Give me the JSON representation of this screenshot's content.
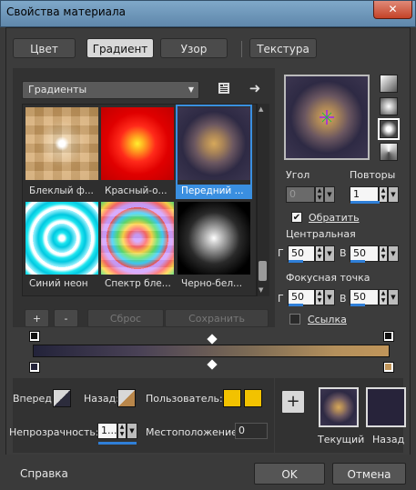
{
  "window": {
    "title": "Свойства материала",
    "close_label": "✕"
  },
  "tabs": [
    {
      "label": "Цвет"
    },
    {
      "label": "Градиент"
    },
    {
      "label": "Узор"
    },
    {
      "label": "Текстура"
    }
  ],
  "gallery": {
    "category": "Градиенты",
    "items": [
      {
        "label": "Блеклый ф..."
      },
      {
        "label": "Красный-о..."
      },
      {
        "label": "Передний ..."
      },
      {
        "label": "Синий неон"
      },
      {
        "label": "Спектр бле..."
      },
      {
        "label": "Черно-бел..."
      }
    ],
    "selected_index": 2
  },
  "gallery_buttons": {
    "add": "+",
    "remove": "-",
    "reset": "Сброс",
    "save": "Сохранить"
  },
  "options": {
    "angle_label": "Угол",
    "angle_value": "0",
    "repeats_label": "Повторы",
    "repeats_value": "1",
    "invert_label": "Обратить",
    "invert_checked": true,
    "center_label": "Центральная",
    "center_h": "50",
    "center_v": "50",
    "focal_label": "Фокусная точка",
    "focal_h": "50",
    "focal_v": "50",
    "link_label": "Ссылка",
    "link_checked": false,
    "h_letter": "Г",
    "v_letter": "В"
  },
  "editor": {
    "forward_label": "Вперед:",
    "back_label": "Назад:",
    "user_label": "Пользователь:",
    "opacity_label": "Непрозрачность:",
    "opacity_value": "1...",
    "location_label": "Местоположение:",
    "location_value": "0",
    "add_stop_label": "+",
    "user_color": "#f2c200"
  },
  "swatches": {
    "current_label": "Текущий",
    "back_label": "Назад",
    "back_color": "#27233a"
  },
  "footer": {
    "help": "Справка",
    "ok": "OK",
    "cancel": "Отмена"
  }
}
